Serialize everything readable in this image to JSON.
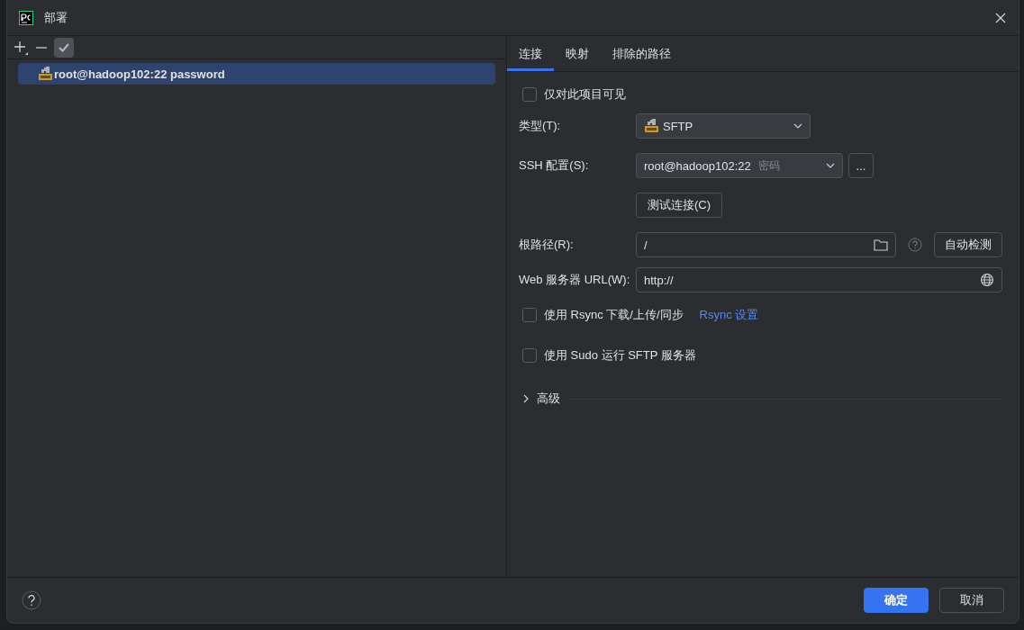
{
  "window": {
    "title": "部署"
  },
  "servers": [
    {
      "name": "root@hadoop102:22 password",
      "selected": true
    }
  ],
  "tabs": [
    {
      "label": "连接",
      "selected": true
    },
    {
      "label": "映射",
      "selected": false
    },
    {
      "label": "排除的路径",
      "selected": false
    }
  ],
  "visible_only": {
    "label": "仅对此项目可见",
    "checked": false
  },
  "type": {
    "label": "类型(T):",
    "value": "SFTP"
  },
  "ssh_config": {
    "label": "SSH 配置(S):",
    "value": "root@hadoop102:22",
    "hint": "密码",
    "more_button": "..."
  },
  "test_button": "测试连接(C)",
  "root_path": {
    "label": "根路径(R):",
    "value": "/",
    "autodetect_button": "自动检测"
  },
  "web_url": {
    "label": "Web 服务器 URL(W):",
    "value": "http://"
  },
  "options": [
    {
      "label": "使用 Rsync 下载/上传/同步",
      "checked": false,
      "link": "Rsync 设置"
    },
    {
      "label": "使用 Sudo 运行 SFTP 服务器",
      "checked": false
    }
  ],
  "advanced": {
    "label": "高级",
    "expanded": false
  },
  "buttons": [
    {
      "label": "确定",
      "kind": "primary"
    },
    {
      "label": "取消",
      "kind": "secondary"
    }
  ]
}
